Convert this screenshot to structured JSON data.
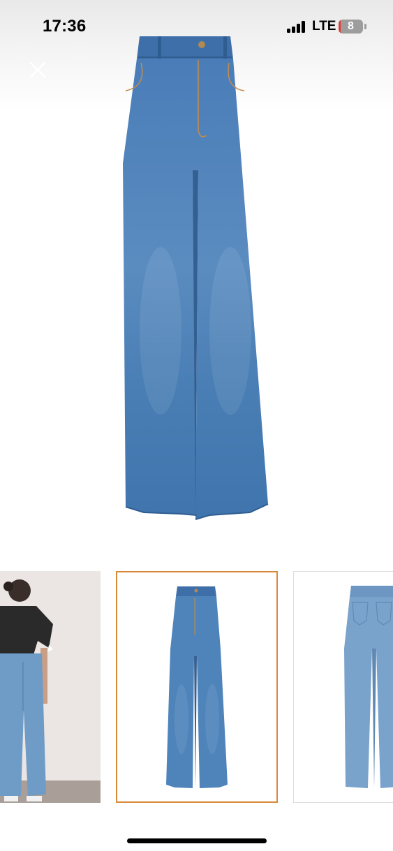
{
  "status_bar": {
    "time": "17:36",
    "network": "LTE",
    "battery_level": "8",
    "battery_color": "#e03b2e"
  },
  "header": {
    "close_icon": "close-icon"
  },
  "main_image": {
    "icon": "jeans-front-photo",
    "denim_color": "#4a7fb5"
  },
  "thumbnails": [
    {
      "icon": "model-back-view-photo",
      "selected": false
    },
    {
      "icon": "jeans-front-photo",
      "selected": true,
      "border_color": "#d9893a"
    },
    {
      "icon": "jeans-back-photo",
      "selected": false
    }
  ]
}
